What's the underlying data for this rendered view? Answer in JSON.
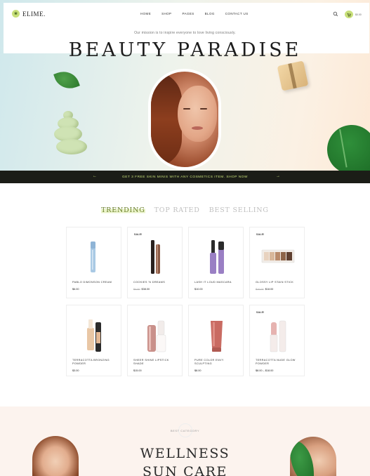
{
  "header": {
    "logo": "ELIME.",
    "nav": [
      "HOME",
      "SHOP",
      "PAGES",
      "BLOG",
      "CONTACT US"
    ],
    "cart_total": "$0.00"
  },
  "hero": {
    "tagline": "Our mission is to inspire everyone to love living consciously.",
    "title": "BEAUTY PARADISE"
  },
  "promo": {
    "text": "GET 3 FREE SKIN MINIS WITH ANY COSMETICS ITEM. SHOP NOW",
    "prev": "←",
    "next": "→"
  },
  "tabs": [
    {
      "label": "TRENDING",
      "active": true
    },
    {
      "label": "TOP RATED",
      "active": false
    },
    {
      "label": "BEST SELLING",
      "active": false
    }
  ],
  "sale_label": "SALE!",
  "products": [
    {
      "name": "PABLO DIMONSON CREAM",
      "old_price": "",
      "price": "$6.00",
      "sale": false,
      "icon": "concealer-stick-icon",
      "color": "#a9c9e4"
    },
    {
      "name": "COOKIES 'N DREAMS",
      "old_price": "$4.00",
      "price": "$38.00",
      "sale": true,
      "icon": "mascara-icon",
      "color": "#8a5a45"
    },
    {
      "name": "LASH IT LOUD MASCARA",
      "old_price": "",
      "price": "$10.00",
      "sale": false,
      "icon": "mascara-icon",
      "color": "#9a7fc4"
    },
    {
      "name": "GLOSSY LIP STAIN STICK",
      "old_price": "$10.00",
      "price": "$18.00",
      "sale": true,
      "icon": "eyeshadow-palette-icon",
      "color": "#d2b49c"
    },
    {
      "name": "TERRACOTTA BRONZING POWDER",
      "old_price": "",
      "price": "$3.00",
      "sale": false,
      "icon": "foundation-bottle-icon",
      "color": "#e9c7a5"
    },
    {
      "name": "SHEER SHINE LIPSTICK SHADE",
      "old_price": "",
      "price": "$15.00",
      "sale": false,
      "icon": "lip-gloss-icon",
      "color": "#c9908a"
    },
    {
      "name": "PURE COLOR ENVY SCULPTING",
      "old_price": "",
      "price": "$8.00",
      "sale": false,
      "icon": "lip-tube-icon",
      "color": "#c96b62"
    },
    {
      "name": "TERRACOTTA NUDE GLOW POWDER",
      "old_price": "",
      "price": "$8.00 – $18.00",
      "sale": true,
      "icon": "lipstick-icon",
      "color": "#e6b3b0"
    }
  ],
  "category": {
    "eyebrow": "BEST CATEGORY",
    "items": [
      "WELLNESS",
      "SUN CARE"
    ]
  },
  "colors": {
    "accent": "#c8e07a",
    "dark_bar": "#1b1d17",
    "active_tab": "#6a7f2c"
  }
}
